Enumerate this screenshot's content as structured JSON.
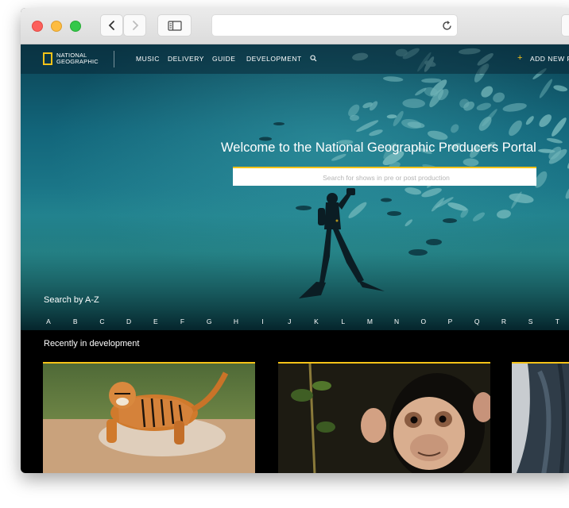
{
  "nav": {
    "logo_line1": "NATIONAL",
    "logo_line2": "GEOGRAPHIC",
    "items": [
      "MUSIC",
      "DELIVERY",
      "GUIDE",
      "DEVELOPMENT"
    ],
    "add_new": "ADD NEW P"
  },
  "hero": {
    "welcome": "Welcome to the National Geographic Producers Portal",
    "search_placeholder": "Search for shows in pre or post production"
  },
  "az": {
    "title": "Search by A-Z",
    "letters": [
      "A",
      "B",
      "C",
      "D",
      "E",
      "F",
      "G",
      "H",
      "I",
      "J",
      "K",
      "L",
      "M",
      "N",
      "O",
      "P",
      "Q",
      "R",
      "S",
      "T"
    ]
  },
  "recent": {
    "title": "Recently in development"
  },
  "colors": {
    "accent": "#f5c318",
    "nav_bg": "#0a2837",
    "ocean": "#1f7e8e"
  }
}
